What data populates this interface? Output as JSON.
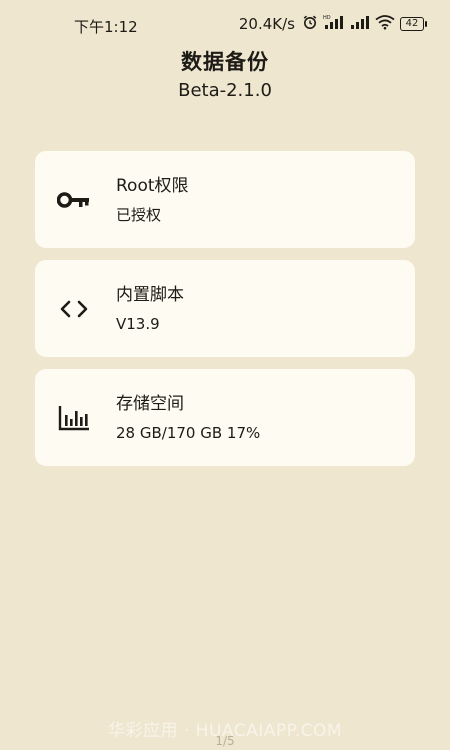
{
  "status_bar": {
    "time": "下午1:12",
    "net_speed": "20.4K/s",
    "battery": "42",
    "icons": [
      "alarm-icon",
      "hd-signal-icon",
      "signal-icon",
      "wifi-icon",
      "battery-icon"
    ]
  },
  "header": {
    "title": "数据备份",
    "version": "Beta-2.1.0"
  },
  "cards": [
    {
      "icon": "key-icon",
      "title": "Root权限",
      "subtitle": "已授权"
    },
    {
      "icon": "code-icon",
      "title": "内置脚本",
      "subtitle": "V13.9"
    },
    {
      "icon": "bar-chart-icon",
      "title": "存储空间",
      "subtitle": "28 GB/170 GB 17%"
    }
  ],
  "watermark": "华彩应用 · HUACAIAPP.COM",
  "page_indicator": "1/5",
  "colors": {
    "background": "#efe6d0",
    "card": "#fefbf3",
    "text": "#1d1b16"
  }
}
